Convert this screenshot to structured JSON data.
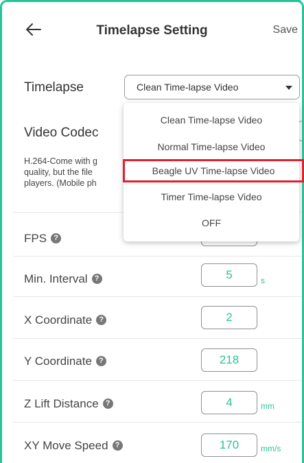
{
  "header": {
    "title": "Timelapse Setting",
    "save_label": "Save"
  },
  "timelapse": {
    "label": "Timelapse",
    "selected": "Clean Time-lapse Video",
    "options": [
      "Clean Time-lapse Video",
      "Normal Time-lapse Video",
      "Beagle UV Time-lapse Video",
      "Timer Time-lapse Video",
      "OFF"
    ],
    "highlighted_option": "Beagle UV Time-lapse Video"
  },
  "video_codec": {
    "label": "Video Codec",
    "description_lines": [
      "H.264-Come with g",
      "quality, but the file",
      "players. (Mobile ph"
    ]
  },
  "settings": {
    "fps": {
      "label": "FPS"
    },
    "min_interval": {
      "label": "Min. Interval",
      "value": "5",
      "unit": "s"
    },
    "x_coordinate": {
      "label": "X Coordinate",
      "value": "2"
    },
    "y_coordinate": {
      "label": "Y Coordinate",
      "value": "218"
    },
    "z_lift_distance": {
      "label": "Z Lift Distance",
      "value": "4",
      "unit": "mm"
    },
    "xy_move_speed": {
      "label": "XY Move Speed",
      "value": "170",
      "unit": "mm/s"
    }
  },
  "icons": {
    "back": "arrow-left-icon",
    "help": "question-circle-icon",
    "caret": "caret-down-icon"
  },
  "colors": {
    "accent": "#27c49a",
    "highlight": "#e0202f",
    "help_icon_bg": "#777777"
  },
  "help_glyph": "?"
}
